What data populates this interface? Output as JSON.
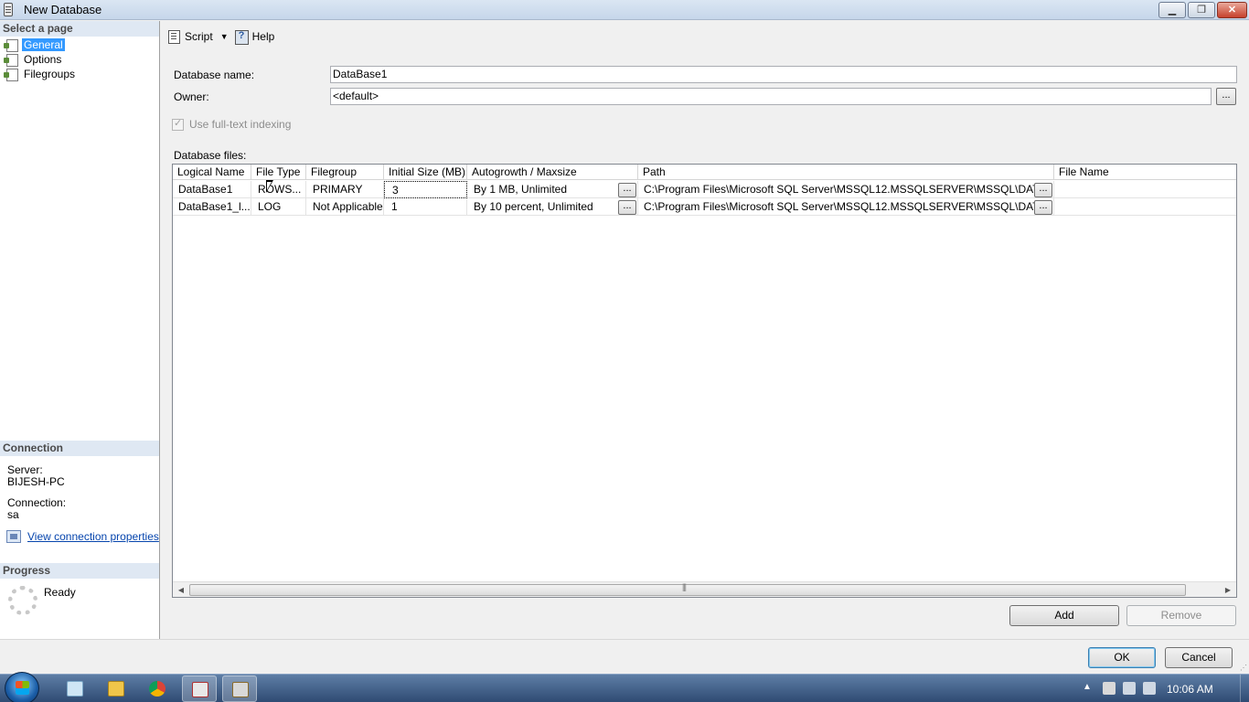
{
  "window": {
    "title": "New Database",
    "minimize_icon": "minimize-icon",
    "restore_icon": "restore-icon",
    "close_icon": "close-icon"
  },
  "left_panel": {
    "select_page_header": "Select a page",
    "pages": [
      {
        "label": "General",
        "selected": true
      },
      {
        "label": "Options",
        "selected": false
      },
      {
        "label": "Filegroups",
        "selected": false
      }
    ],
    "connection_header": "Connection",
    "server_label": "Server:",
    "server_value": "BIJESH-PC",
    "connection_label": "Connection:",
    "connection_value": "sa",
    "view_connection_link": "View connection properties",
    "progress_header": "Progress",
    "progress_status": "Ready"
  },
  "toolbar": {
    "script_label": "Script",
    "help_label": "Help"
  },
  "form": {
    "database_name_label": "Database name:",
    "database_name_value": "DataBase1",
    "owner_label": "Owner:",
    "owner_value": "<default>",
    "owner_browse": "...",
    "fulltext_label": "Use full-text indexing",
    "fulltext_checked": true,
    "database_files_label": "Database files:"
  },
  "files_grid": {
    "columns": [
      "Logical Name",
      "File Type",
      "Filegroup",
      "Initial Size (MB)",
      "Autogrowth / Maxsize",
      "Path",
      "File Name"
    ],
    "rows": [
      {
        "logical_name": "DataBase1",
        "file_type": "ROWS...",
        "filegroup": "PRIMARY",
        "initial_size": "3",
        "autogrowth": "By 1 MB, Unlimited",
        "path": "C:\\Program Files\\Microsoft SQL Server\\MSSQL12.MSSQLSERVER\\MSSQL\\DATA\\",
        "file_name": ""
      },
      {
        "logical_name": "DataBase1_l...",
        "file_type": "LOG",
        "filegroup": "Not Applicable",
        "initial_size": "1",
        "autogrowth": "By 10 percent, Unlimited",
        "path": "C:\\Program Files\\Microsoft SQL Server\\MSSQL12.MSSQLSERVER\\MSSQL\\DATA\\",
        "file_name": ""
      }
    ],
    "ellipsis": "..."
  },
  "buttons": {
    "add": "Add",
    "remove": "Remove",
    "ok": "OK",
    "cancel": "Cancel"
  },
  "taskbar": {
    "clock": "10:06 AM",
    "tray_arrow": "▲"
  }
}
